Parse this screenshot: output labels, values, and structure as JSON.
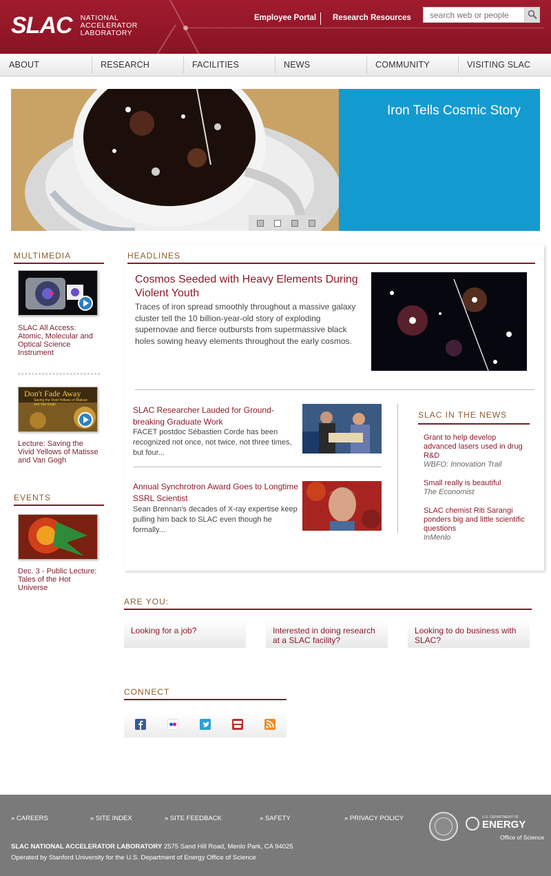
{
  "header": {
    "logo_mark": "SLAC",
    "logo_lines": [
      "NATIONAL",
      "ACCELERATOR",
      "LABORATORY"
    ],
    "links": [
      "Employee Portal",
      "Research Resources"
    ],
    "search_placeholder": "search web or people"
  },
  "nav": [
    "ABOUT",
    "RESEARCH",
    "FACILITIES",
    "NEWS",
    "COMMUNITY",
    "VISITING SLAC"
  ],
  "hero": {
    "title": "Iron Tells Cosmic Story",
    "slides": 4,
    "active_slide": 2
  },
  "multimedia": {
    "title": "MULTIMEDIA",
    "items": [
      {
        "caption": "SLAC All Access: Atomic, Molecular and Optical Science Instrument"
      },
      {
        "caption": "Lecture: Saving the Vivid Yellows of Matisse and Van Gogh",
        "thumb_text": "Don't Fade Away",
        "thumb_sub": "Saving the Vivid Yellows of Matisse and Van Gogh"
      }
    ]
  },
  "events": {
    "title": "EVENTS",
    "items": [
      {
        "caption": "Dec. 3 - Public Lecture: Tales of the Hot Universe"
      }
    ]
  },
  "headlines": {
    "title": "HEADLINES",
    "lead": {
      "title": "Cosmos Seeded with Heavy Elements During Violent Youth",
      "desc": "Traces of iron spread smoothly throughout a massive galaxy cluster tell the 10 billion-year-old story of exploding supernovae and fierce outbursts from supermassive black holes sowing heavy elements throughout the early cosmos."
    },
    "stories": [
      {
        "title": "SLAC Researcher Lauded for Ground-breaking Graduate Work",
        "desc": "FACET postdoc Sébastien Corde has been recognized not once, not twice, not three times, but four..."
      },
      {
        "title": "Annual Synchrotron Award Goes to Longtime SSRL Scientist",
        "desc": "Sean Brennan's decades of X-ray expertise keep pulling him back to SLAC even though he formally..."
      }
    ]
  },
  "in_the_news": {
    "title": "SLAC IN THE NEWS",
    "items": [
      {
        "title": "Grant to help develop advanced lasers used in drug R&D",
        "source": "WBFO: Innovation Trail"
      },
      {
        "title": "Small really is beautiful",
        "source": "The Economist"
      },
      {
        "title": "SLAC chemist Riti Sarangi ponders big and little scientific questions",
        "source": "InMenlo"
      }
    ]
  },
  "are_you": {
    "title": "ARE YOU:",
    "items": [
      "Looking for a job?",
      "Interested in doing research at a SLAC facility?",
      "Looking to do business with SLAC?"
    ]
  },
  "connect": {
    "title": "CONNECT",
    "icons": [
      "facebook-icon",
      "flickr-icon",
      "twitter-icon",
      "youtube-icon",
      "rss-icon"
    ]
  },
  "footer": {
    "links": [
      "» CAREERS",
      "» SITE INDEX",
      "» SITE FEEDBACK",
      "» SAFETY",
      "» PRIVACY POLICY"
    ],
    "address_name": "SLAC NATIONAL ACCELERATOR LABORATORY",
    "address": " 2575 Sand Hill Road, Menlo Park, CA 94025",
    "operated": "Operated by Stanford University for the U.S. Department of Energy Office of Science",
    "doe_small": "U.S. DEPARTMENT OF",
    "doe_big": "ENERGY",
    "doe_sub": "Office of Science"
  },
  "colors": {
    "brand_red": "#8b1a2b",
    "hero_blue": "#139bcf",
    "footer_gray": "#7a7a7a"
  }
}
